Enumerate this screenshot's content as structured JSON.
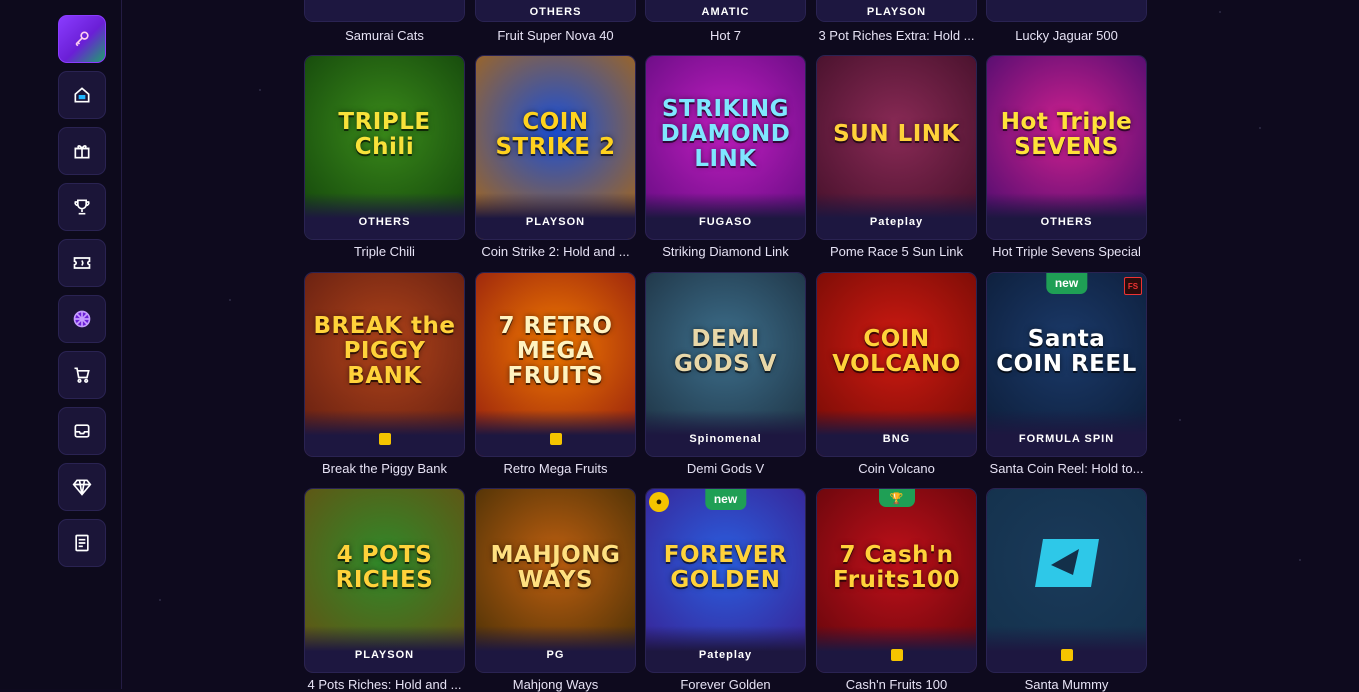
{
  "sidebar": {
    "items": [
      {
        "name": "key-icon",
        "active": true
      },
      {
        "name": "home-icon",
        "active": false
      },
      {
        "name": "gift-icon",
        "active": false
      },
      {
        "name": "trophy-icon",
        "active": false
      },
      {
        "name": "ticket-icon",
        "active": false
      },
      {
        "name": "wheel-icon",
        "active": false
      },
      {
        "name": "cart-icon",
        "active": false
      },
      {
        "name": "inbox-icon",
        "active": false
      },
      {
        "name": "diamond-icon",
        "active": false
      },
      {
        "name": "document-icon",
        "active": false
      }
    ]
  },
  "games_row0": [
    {
      "title": "Samurai Cats",
      "provider": "",
      "logo": ""
    },
    {
      "title": "Fruit Super Nova 40",
      "provider": "OTHERS",
      "logo": ""
    },
    {
      "title": "Hot 7",
      "provider": "AMATIC",
      "logo": ""
    },
    {
      "title": "3 Pot Riches Extra: Hold ...",
      "provider": "PLAYSON",
      "logo": ""
    },
    {
      "title": "Lucky Jaguar 500",
      "provider": "",
      "logo": ""
    }
  ],
  "games": [
    {
      "title": "Triple Chili",
      "provider": "OTHERS",
      "logo": "TRIPLE Chili",
      "colors": [
        "#3a8a1a",
        "#0f3d0a"
      ],
      "logoColor": "#f8e23a"
    },
    {
      "title": "Coin Strike 2: Hold and ...",
      "provider": "PLAYSON",
      "logo": "COIN STRIKE 2",
      "colors": [
        "#1a4fd8",
        "#b86a00"
      ],
      "logoColor": "#ffd21e"
    },
    {
      "title": "Striking Diamond Link",
      "provider": "FUGASO",
      "logo": "STRIKING DIAMOND LINK",
      "colors": [
        "#c01ec0",
        "#5a0a7a"
      ],
      "logoColor": "#7fe7ff"
    },
    {
      "title": "Pome Race 5 Sun Link",
      "provider": "Pateplay",
      "logo": "SUN LINK",
      "colors": [
        "#8a2a56",
        "#3b0d24"
      ],
      "logoColor": "#ffd23a"
    },
    {
      "title": "Hot Triple Sevens Special",
      "provider": "OTHERS",
      "logo": "Hot Triple SEVENS",
      "colors": [
        "#d0208f",
        "#3b0a6a"
      ],
      "logoColor": "#ffe23a"
    },
    {
      "title": "Break the Piggy Bank",
      "provider": "",
      "logo": "BREAK the PIGGY BANK",
      "colors": [
        "#b1441a",
        "#5b1a10"
      ],
      "logoColor": "#ffd23a"
    },
    {
      "title": "Retro Mega Fruits",
      "provider": "",
      "logo": "7 RETRO MEGA FRUITS",
      "colors": [
        "#f27a00",
        "#8a1410"
      ],
      "logoColor": "#fff3c0"
    },
    {
      "title": "Demi Gods V",
      "provider": "Spinomenal",
      "logo": "DEMI GODS V",
      "colors": [
        "#3d6f8c",
        "#1a2b3a"
      ],
      "logoColor": "#e8d7a8"
    },
    {
      "title": "Coin Volcano",
      "provider": "BNG",
      "logo": "COIN VOLCANO",
      "colors": [
        "#d01a12",
        "#6a0a04"
      ],
      "logoColor": "#ffd23a"
    },
    {
      "title": "Santa Coin Reel: Hold to...",
      "provider": "FORMULA SPIN",
      "logo": "Santa COIN REEL",
      "colors": [
        "#1b3a6a",
        "#0b1a33"
      ],
      "logoColor": "#ffffff",
      "badge": "new",
      "corner": "FS"
    },
    {
      "title": "4 Pots Riches: Hold and ...",
      "provider": "PLAYSON",
      "logo": "4 POTS RICHES",
      "colors": [
        "#2f8a2a",
        "#6a4a10"
      ],
      "logoColor": "#ffd23a"
    },
    {
      "title": "Mahjong Ways",
      "provider": "PG",
      "logo": "MAHJONG WAYS",
      "colors": [
        "#c06010",
        "#3a2a05"
      ],
      "logoColor": "#ffe080"
    },
    {
      "title": "Forever Golden",
      "provider": "Pateplay",
      "logo": "FOREVER GOLDEN",
      "colors": [
        "#2a5fe0",
        "#3a1a8a"
      ],
      "logoColor": "#ffd23a",
      "badge": "new",
      "coin": true
    },
    {
      "title": "Cash'n Fruits 100",
      "provider": "",
      "logo": "7 Cash'n Fruits100",
      "colors": [
        "#c0101a",
        "#5a050a"
      ],
      "logoColor": "#ffd23a",
      "trophy": true
    },
    {
      "title": "Santa Mummy",
      "provider": "",
      "logo": "",
      "colors": [
        "#1a3a5a",
        "#13304a"
      ],
      "logoColor": "#2ec8e8",
      "placeholder": true
    }
  ]
}
